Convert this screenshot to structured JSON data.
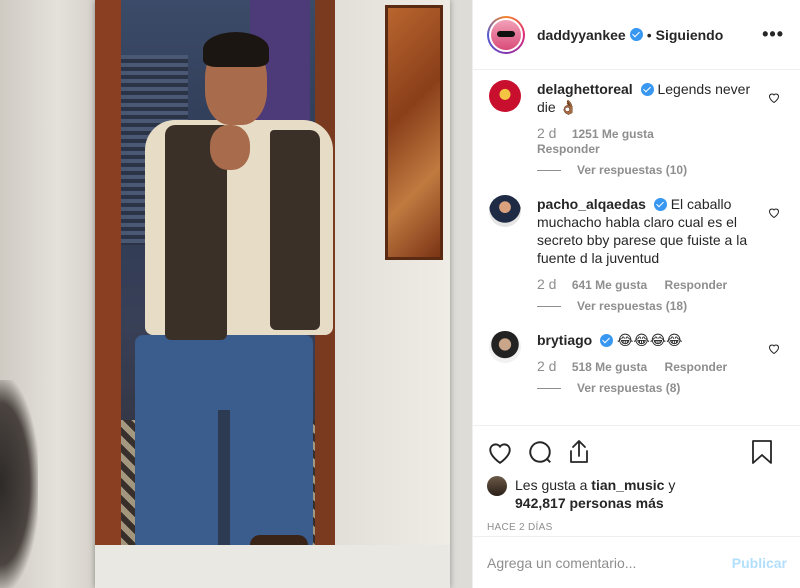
{
  "post_author": {
    "username": "daddyyankee",
    "follow_status": "Siguiendo",
    "more_icon": "ellipsis-icon"
  },
  "comments": [
    {
      "username": "delaghettoreal",
      "verified": true,
      "text": "Legends never die 👌🏾",
      "time": "2 d",
      "likes": "1251 Me gusta",
      "reply_label": "Responder",
      "view_replies": "Ver respuestas (10)"
    },
    {
      "username": "pacho_alqaedas",
      "verified": true,
      "text": "El caballo muchacho habla claro cual es el secreto bby parese que fuiste a la fuente d la juventud",
      "time": "2 d",
      "likes": "641 Me gusta",
      "reply_label": "Responder",
      "view_replies": "Ver respuestas (18)"
    },
    {
      "username": "brytiago",
      "verified": true,
      "text": "😂😂😂😂",
      "time": "2 d",
      "likes": "518 Me gusta",
      "reply_label": "Responder",
      "view_replies": "Ver respuestas (8)"
    }
  ],
  "likes": {
    "prefix": "Les gusta a",
    "user": "tian_music",
    "conjunction": "y",
    "others": "942,817 personas más"
  },
  "posted_ago": "HACE 2 DÍAS",
  "comment_box": {
    "placeholder": "Agrega un comentario...",
    "publish_label": "Publicar"
  },
  "colors": {
    "verified_blue": "#3897f0",
    "muted_text": "#8e8e8e",
    "publish_disabled": "#b2dffc"
  }
}
